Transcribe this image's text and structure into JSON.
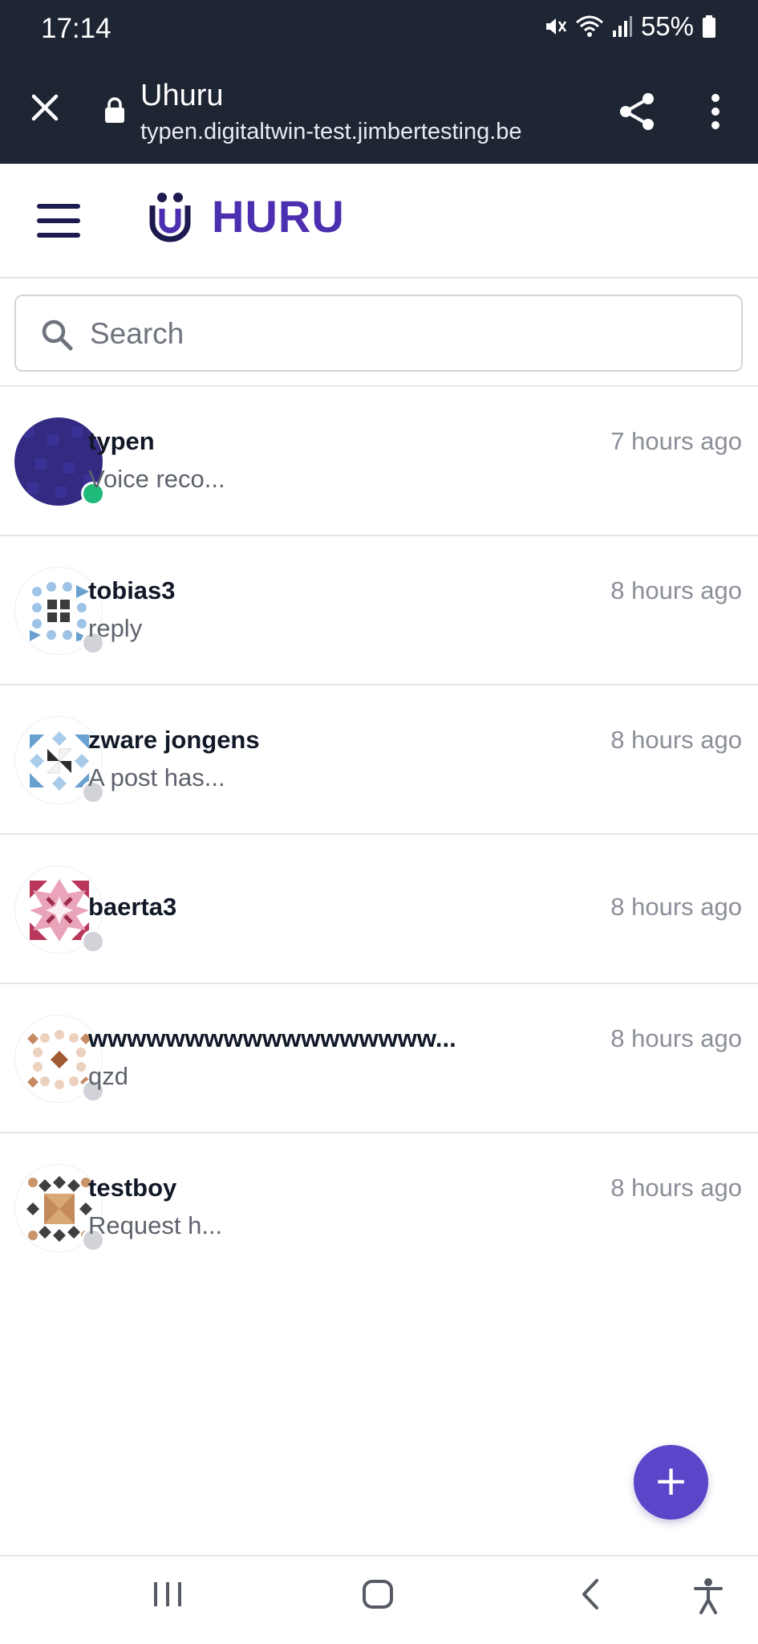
{
  "status_bar": {
    "time": "17:14",
    "battery": "55%"
  },
  "browser_tab": {
    "title": "Uhuru",
    "url": "typen.digitaltwin-test.jimbertesting.be"
  },
  "header": {
    "logo_text": "HURU"
  },
  "search": {
    "placeholder": "Search",
    "value": ""
  },
  "chats": [
    {
      "name": "typen",
      "preview": "Voice reco...",
      "time": "7 hours ago",
      "status": "online"
    },
    {
      "name": "tobias3",
      "preview": "reply",
      "time": "8 hours ago",
      "status": "offline"
    },
    {
      "name": "zware jongens",
      "preview": "A post has...",
      "time": "8 hours ago",
      "status": "offline"
    },
    {
      "name": "baerta3",
      "preview": "",
      "time": "8 hours ago",
      "status": "offline"
    },
    {
      "name": "wwwwwwwwwwwwwwwwww...",
      "preview": "qzd",
      "time": "8 hours ago",
      "status": "offline"
    },
    {
      "name": "testboy",
      "preview": "Request h...",
      "time": "8 hours ago",
      "status": "offline"
    }
  ],
  "colors": {
    "chrome": "#1e2533",
    "brand": "#4b2fb0",
    "fab": "#5c45c8",
    "online": "#1fb97a",
    "offline": "#d1d3d9"
  },
  "fab": {
    "icon": "plus-icon",
    "label": "+"
  },
  "nav": [
    "recent-apps-icon",
    "home-icon",
    "back-icon",
    "accessibility-icon"
  ]
}
